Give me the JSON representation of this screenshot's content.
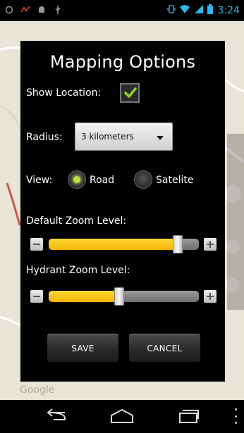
{
  "status_bar": {
    "time": "3:24",
    "left_icons": [
      "notification-icon",
      "signal-app-icon",
      "android-debug-icon",
      "usb-icon"
    ],
    "right_icons": [
      "vibrate-icon",
      "wifi-icon",
      "cell-signal-icon",
      "battery-icon"
    ]
  },
  "map": {
    "watermark": "Google"
  },
  "dialog": {
    "title": "Mapping Options",
    "show_location": {
      "label": "Show Location:",
      "checked": true
    },
    "radius": {
      "label": "Radius:",
      "selected": "3 kilometers"
    },
    "view": {
      "label": "View:",
      "options": [
        {
          "label": "Road",
          "selected": true
        },
        {
          "label": "Satelite",
          "selected": false
        }
      ]
    },
    "default_zoom": {
      "label": "Default Zoom Level:",
      "fraction": 0.86
    },
    "hydrant_zoom": {
      "label": "Hydrant Zoom Level:",
      "fraction": 0.47
    },
    "buttons": {
      "save": "SAVE",
      "cancel": "CANCEL"
    }
  },
  "colors": {
    "accent_yellow": "#f4b400",
    "checkbox_green": "#8fd321",
    "radio_on": "#b6e63f",
    "status_blue": "#33b5e5"
  }
}
